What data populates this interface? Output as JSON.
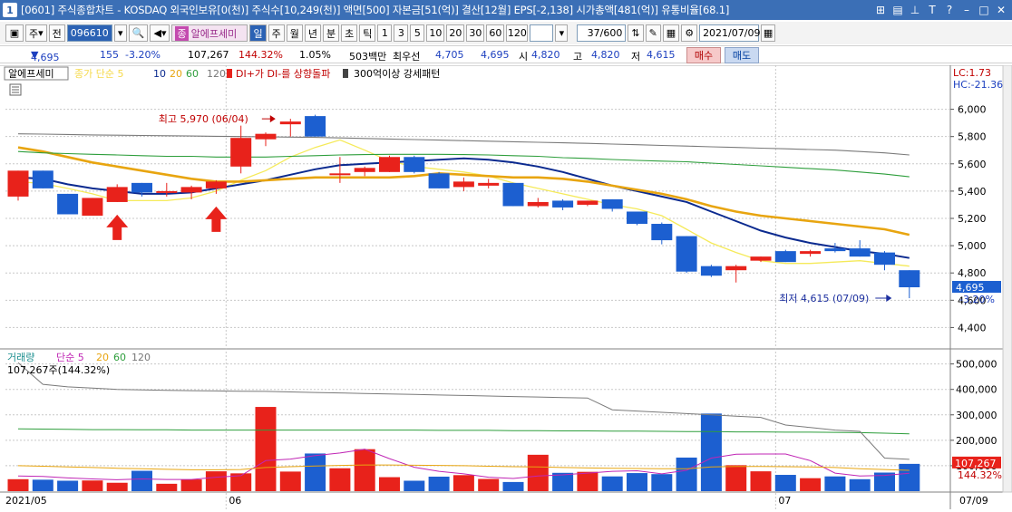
{
  "window": {
    "number": "1",
    "title": "[0601] 주식종합차트 - KOSDAQ 외국인보유[0(천)] 주식수[10,249(천)] 액면[500] 자본금[51(억)] 결산[12월] EPS[-2,138] 시가총액[481(억)] 유통비율[68.1]",
    "controls": [
      "⊞",
      "▤",
      "⊥",
      "T",
      "?",
      "–",
      "□",
      "✕"
    ]
  },
  "toolbar": {
    "main_label": "주",
    "prev_label": "전",
    "code": "096610",
    "stock_name": "알에프세미",
    "period_day": "일",
    "period_week": "주",
    "period_month": "월",
    "period_year": "년",
    "period_min": "분",
    "period_sec": "초",
    "period_tick": "틱",
    "intervals": [
      "1",
      "3",
      "5",
      "10",
      "20",
      "30",
      "60",
      "120"
    ],
    "count": "37/600",
    "date": "2021/07/09"
  },
  "quote": {
    "price": "4,695",
    "change": "155",
    "change_pct": "-3.20%",
    "volume": "107,267",
    "volume_pct": "144.32%",
    "turnover": "1.05%",
    "amount": "503백만",
    "best_bid_label": "최우선",
    "best_ask": "4,705",
    "best_bid": "4,695",
    "open_label": "시",
    "open": "4,820",
    "high_label": "고",
    "high": "4,820",
    "low_label": "저",
    "low": "4,615",
    "buy_label": "매수",
    "sell_label": "매도"
  },
  "price_legend": {
    "name": "알에프세미",
    "ma_label": "종가 단순 5",
    "ma10": "10",
    "ma20": "20",
    "ma60": "60",
    "ma120": "120",
    "signal": "DI+가 DI-를 상향돌파",
    "pattern": "300억이상 강세패턴"
  },
  "volume_legend": {
    "name": "거래량",
    "ma_label": "단순 5",
    "ma20": "20",
    "ma60": "60",
    "ma120": "120",
    "current": "107,267주(144.32%)"
  },
  "indicators": {
    "lc": "LC:1.73",
    "hc": "HC:-21.36"
  },
  "annotations": {
    "high": "최고 5,970 (06/04)",
    "low": "최저 4,615 (07/09)"
  },
  "last_price_label": "4,695",
  "last_change_label": "-3.20%",
  "last_volume_label": "107,267",
  "last_volume_pct": "144.32%",
  "colors": {
    "up": "#e8221b",
    "down": "#1c5fd0",
    "ma5": "#f5ea5a",
    "ma10": "#0b2a8f",
    "ma20": "#e8a510",
    "ma60": "#2e9e3c",
    "ma120": "#7a7a7a"
  },
  "chart_data": {
    "type": "candlestick",
    "price_axis": {
      "ticks": [
        4400,
        4600,
        4800,
        5000,
        5200,
        5400,
        5600,
        5800,
        6000
      ],
      "tick_labels": [
        "4,400",
        "4,600",
        "4,800",
        "5,000",
        "5,200",
        "5,400",
        "5,600",
        "5,800",
        "6,000"
      ],
      "ylim": [
        4250,
        6150
      ]
    },
    "volume_axis": {
      "ticks": [
        100000,
        200000,
        300000,
        400000,
        500000
      ],
      "tick_labels": [
        "100,000",
        "200,000",
        "300,000",
        "400,000",
        "500,000"
      ],
      "ylim": [
        0,
        520000
      ]
    },
    "x_labels": [
      "2021/05",
      "06",
      "07",
      "07/09"
    ],
    "candles": [
      {
        "o": 5360,
        "h": 5550,
        "l": 5330,
        "c": 5550
      },
      {
        "o": 5550,
        "h": 5550,
        "l": 5420,
        "c": 5420
      },
      {
        "o": 5380,
        "h": 5380,
        "l": 5230,
        "c": 5230
      },
      {
        "o": 5220,
        "h": 5350,
        "l": 5220,
        "c": 5350
      },
      {
        "o": 5320,
        "h": 5450,
        "l": 5320,
        "c": 5430
      },
      {
        "o": 5460,
        "h": 5460,
        "l": 5360,
        "c": 5390
      },
      {
        "o": 5400,
        "h": 5460,
        "l": 5360,
        "c": 5400
      },
      {
        "o": 5390,
        "h": 5440,
        "l": 5340,
        "c": 5430
      },
      {
        "o": 5420,
        "h": 5480,
        "l": 5380,
        "c": 5470
      },
      {
        "o": 5580,
        "h": 5880,
        "l": 5530,
        "c": 5790
      },
      {
        "o": 5780,
        "h": 5830,
        "l": 5730,
        "c": 5820
      },
      {
        "o": 5890,
        "h": 5930,
        "l": 5800,
        "c": 5910
      },
      {
        "o": 5950,
        "h": 5960,
        "l": 5800,
        "c": 5800
      },
      {
        "o": 5520,
        "h": 5650,
        "l": 5460,
        "c": 5530
      },
      {
        "o": 5540,
        "h": 5580,
        "l": 5510,
        "c": 5570
      },
      {
        "o": 5540,
        "h": 5660,
        "l": 5540,
        "c": 5650
      },
      {
        "o": 5650,
        "h": 5660,
        "l": 5530,
        "c": 5540
      },
      {
        "o": 5530,
        "h": 5540,
        "l": 5420,
        "c": 5420
      },
      {
        "o": 5430,
        "h": 5500,
        "l": 5400,
        "c": 5470
      },
      {
        "o": 5440,
        "h": 5490,
        "l": 5420,
        "c": 5460
      },
      {
        "o": 5460,
        "h": 5460,
        "l": 5290,
        "c": 5290
      },
      {
        "o": 5290,
        "h": 5350,
        "l": 5280,
        "c": 5320
      },
      {
        "o": 5330,
        "h": 5340,
        "l": 5260,
        "c": 5280
      },
      {
        "o": 5300,
        "h": 5330,
        "l": 5290,
        "c": 5330
      },
      {
        "o": 5340,
        "h": 5340,
        "l": 5250,
        "c": 5270
      },
      {
        "o": 5250,
        "h": 5250,
        "l": 5150,
        "c": 5160
      },
      {
        "o": 5160,
        "h": 5170,
        "l": 5010,
        "c": 5040
      },
      {
        "o": 5070,
        "h": 5070,
        "l": 4800,
        "c": 4810
      },
      {
        "o": 4850,
        "h": 4860,
        "l": 4770,
        "c": 4780
      },
      {
        "o": 4820,
        "h": 4860,
        "l": 4730,
        "c": 4850
      },
      {
        "o": 4890,
        "h": 4920,
        "l": 4880,
        "c": 4920
      },
      {
        "o": 4960,
        "h": 4970,
        "l": 4880,
        "c": 4880
      },
      {
        "o": 4940,
        "h": 4970,
        "l": 4920,
        "c": 4960
      },
      {
        "o": 4980,
        "h": 5020,
        "l": 4950,
        "c": 4960
      },
      {
        "o": 4980,
        "h": 5040,
        "l": 4920,
        "c": 4920
      },
      {
        "o": 4950,
        "h": 4960,
        "l": 4820,
        "c": 4860
      },
      {
        "o": 4820,
        "h": 4820,
        "l": 4615,
        "c": 4695
      }
    ],
    "volumes": [
      47000,
      45000,
      41000,
      42000,
      33000,
      80000,
      29000,
      46000,
      78000,
      70000,
      331000,
      77000,
      148000,
      90000,
      165000,
      55000,
      41000,
      57000,
      63000,
      48000,
      36000,
      143000,
      72000,
      76000,
      58000,
      71000,
      67000,
      132000,
      305000,
      102000,
      78000,
      64000,
      51000,
      58000,
      47000,
      73000,
      107267
    ],
    "series": [
      {
        "name": "5",
        "values": [
          5470,
          5455,
          5420,
          5380,
          5330,
          5330,
          5330,
          5350,
          5400,
          5480,
          5550,
          5650,
          5720,
          5775,
          5700,
          5620,
          5580,
          5560,
          5540,
          5510,
          5460,
          5420,
          5380,
          5340,
          5300,
          5270,
          5220,
          5120,
          5020,
          4950,
          4890,
          4870,
          4870,
          4880,
          4890,
          4870,
          4850
        ]
      },
      {
        "name": "10",
        "values": [
          5500,
          5490,
          5450,
          5420,
          5400,
          5380,
          5380,
          5390,
          5420,
          5450,
          5480,
          5520,
          5560,
          5590,
          5600,
          5610,
          5620,
          5630,
          5640,
          5630,
          5610,
          5580,
          5540,
          5490,
          5440,
          5400,
          5360,
          5320,
          5250,
          5180,
          5110,
          5060,
          5020,
          4990,
          4960,
          4940,
          4910
        ]
      },
      {
        "name": "20",
        "values": [
          5720,
          5690,
          5650,
          5610,
          5580,
          5550,
          5520,
          5490,
          5470,
          5470,
          5480,
          5490,
          5500,
          5500,
          5500,
          5500,
          5510,
          5530,
          5520,
          5510,
          5500,
          5500,
          5490,
          5470,
          5440,
          5410,
          5380,
          5340,
          5290,
          5250,
          5220,
          5200,
          5180,
          5160,
          5140,
          5120,
          5080
        ]
      },
      {
        "name": "60",
        "values": [
          5690,
          5680,
          5675,
          5670,
          5665,
          5660,
          5655,
          5655,
          5650,
          5650,
          5650,
          5655,
          5660,
          5665,
          5668,
          5670,
          5670,
          5670,
          5668,
          5665,
          5660,
          5655,
          5645,
          5640,
          5632,
          5625,
          5620,
          5615,
          5605,
          5595,
          5585,
          5575,
          5565,
          5555,
          5540,
          5525,
          5505
        ]
      },
      {
        "name": "120",
        "values": [
          5820,
          5818,
          5815,
          5812,
          5810,
          5808,
          5806,
          5804,
          5802,
          5800,
          5798,
          5796,
          5794,
          5790,
          5786,
          5782,
          5778,
          5774,
          5770,
          5766,
          5762,
          5758,
          5754,
          5750,
          5745,
          5740,
          5735,
          5730,
          5725,
          5720,
          5715,
          5710,
          5705,
          5700,
          5690,
          5680,
          5665
        ]
      }
    ],
    "volume_series": [
      {
        "name": "5",
        "values": [
          60000,
          58000,
          52000,
          48000,
          45000,
          48000,
          46000,
          46000,
          55000,
          61000,
          120000,
          126000,
          140000,
          150000,
          165000,
          128000,
          94000,
          78000,
          68000,
          55000,
          50000,
          60000,
          64000,
          71000,
          78000,
          80000,
          68000,
          82000,
          130000,
          145000,
          146000,
          146000,
          120000,
          71000,
          60000,
          62000,
          70000
        ]
      },
      {
        "name": "20",
        "values": [
          100000,
          98000,
          95000,
          93000,
          90000,
          88000,
          86000,
          84000,
          84000,
          85000,
          93000,
          96000,
          99000,
          101000,
          103000,
          103000,
          102000,
          101000,
          100000,
          98000,
          96000,
          95000,
          93000,
          91000,
          90000,
          89000,
          88000,
          88000,
          95000,
          97000,
          97000,
          96000,
          95000,
          93000,
          88000,
          85000,
          82000
        ]
      },
      {
        "name": "60",
        "values": [
          245000,
          244000,
          243000,
          242000,
          242000,
          241000,
          241000,
          240000,
          240000,
          240000,
          240000,
          240000,
          240000,
          240000,
          240000,
          240000,
          240000,
          239000,
          239000,
          239000,
          238000,
          238000,
          237000,
          237000,
          236000,
          236000,
          235000,
          234000,
          234000,
          233000,
          233000,
          232000,
          232000,
          231000,
          230000,
          228000,
          225000
        ]
      },
      {
        "name": "120",
        "values": [
          505000,
          420000,
          410000,
          405000,
          400000,
          398000,
          396000,
          395000,
          394000,
          393000,
          392000,
          390000,
          388000,
          386000,
          384000,
          382000,
          380000,
          378000,
          376000,
          374000,
          372000,
          370000,
          368000,
          366000,
          320000,
          315000,
          310000,
          305000,
          300000,
          295000,
          290000,
          260000,
          250000,
          240000,
          235000,
          130000,
          125000
        ]
      }
    ],
    "signal_arrows_at": [
      4,
      8
    ],
    "high_index": 11,
    "low_index": 36
  }
}
